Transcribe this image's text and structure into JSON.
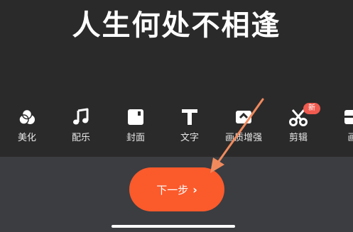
{
  "title": "人生何处不相逢",
  "toolbar": {
    "items": [
      {
        "label": "美化",
        "icon": "beautify-icon"
      },
      {
        "label": "配乐",
        "icon": "music-note-icon"
      },
      {
        "label": "封面",
        "icon": "cover-icon"
      },
      {
        "label": "文字",
        "icon": "text-icon"
      },
      {
        "label": "画质增强",
        "icon": "quality-enhance-icon"
      },
      {
        "label": "剪辑",
        "icon": "scissors-icon"
      },
      {
        "label": "画",
        "icon": "canvas-icon"
      }
    ],
    "new_badge": "新"
  },
  "next_button": {
    "label": "下一步",
    "chevron": "›"
  },
  "colors": {
    "background": "#2b2a2a",
    "panel": "#3b3d41",
    "accent": "#fb5a2b",
    "annotation_arrow": "#f08a5d"
  }
}
